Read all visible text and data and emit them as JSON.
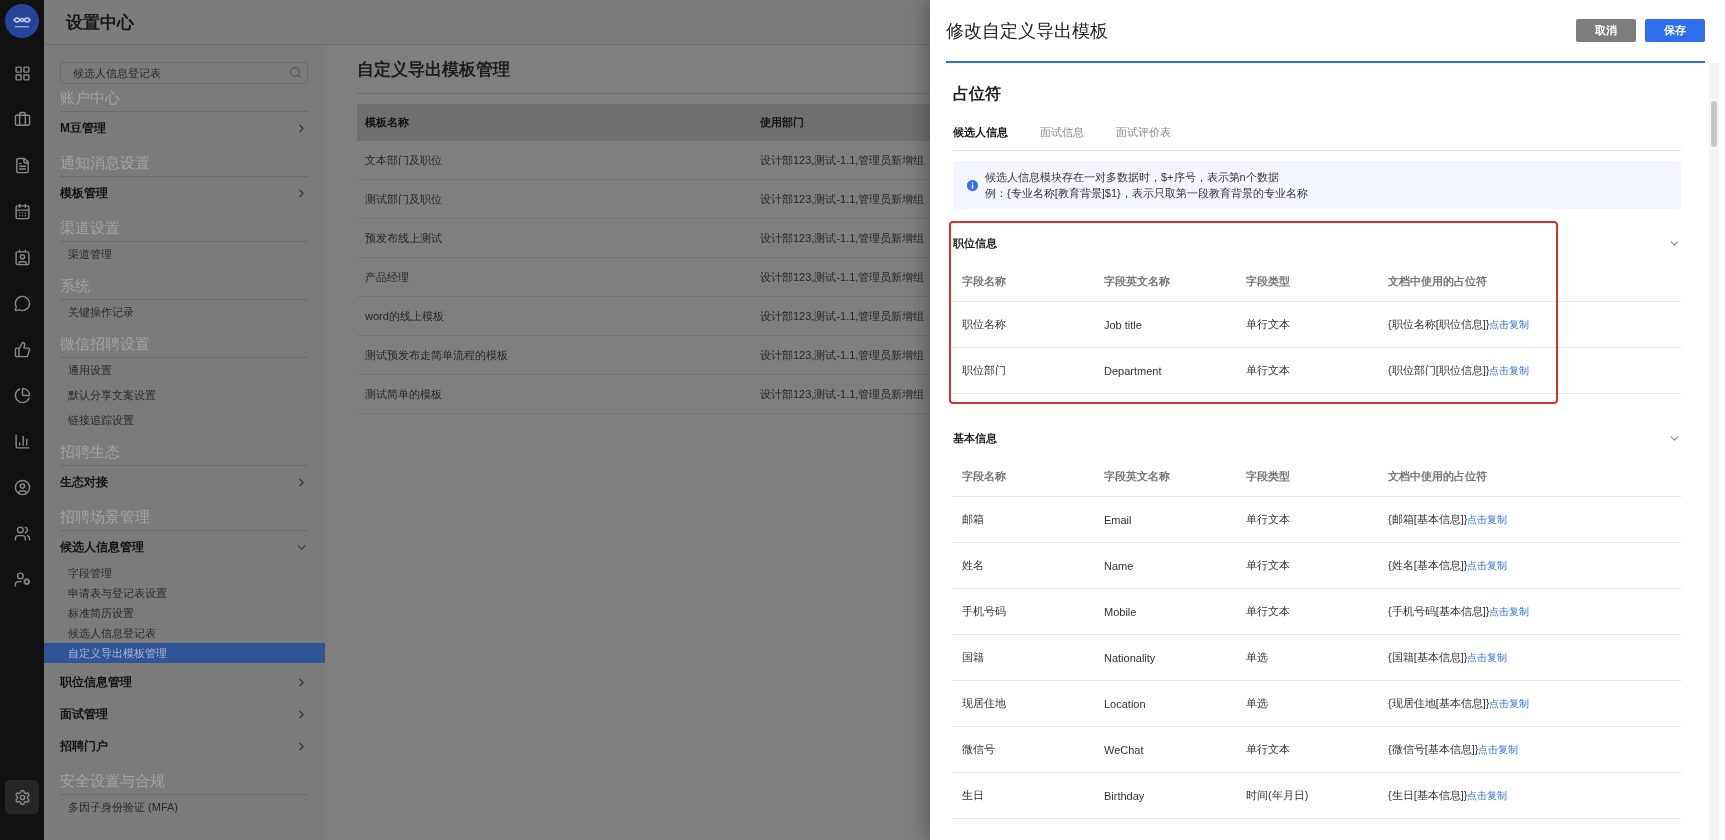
{
  "app_header": {
    "title": "设置中心"
  },
  "rail": [
    {
      "selected": false
    },
    {
      "selected": false
    },
    {
      "selected": false
    },
    {
      "selected": false
    },
    {
      "selected": false
    },
    {
      "selected": false
    },
    {
      "selected": false
    },
    {
      "selected": false
    },
    {
      "selected": false
    },
    {
      "selected": false
    },
    {
      "selected": false
    },
    {
      "selected": false
    },
    {
      "selected": true
    }
  ],
  "settings_nav": {
    "search": {
      "value": "候选人信息登记表"
    },
    "groups": [
      {
        "title": "账户中心",
        "items": [
          {
            "label": "M豆管理",
            "kind": "menu",
            "expanded": false
          }
        ]
      },
      {
        "title": "通知消息设置",
        "items": [
          {
            "label": "模板管理",
            "kind": "menu",
            "expanded": false
          }
        ]
      },
      {
        "title": "渠道设置",
        "items": [
          {
            "label": "渠道管理",
            "kind": "link",
            "selected": false
          }
        ]
      },
      {
        "title": "系统",
        "items": [
          {
            "label": "关键操作记录",
            "kind": "link",
            "selected": false
          }
        ]
      },
      {
        "title": "微信招聘设置",
        "items": [
          {
            "label": "通用设置",
            "kind": "link",
            "selected": false
          },
          {
            "label": "默认分享文案设置",
            "kind": "link",
            "selected": false
          },
          {
            "label": "链接追踪设置",
            "kind": "link",
            "selected": false
          }
        ]
      },
      {
        "title": "招聘生态",
        "items": [
          {
            "label": "生态对接",
            "kind": "menu",
            "expanded": false
          }
        ]
      },
      {
        "title": "招聘场景管理",
        "items": [
          {
            "label": "候选人信息管理",
            "kind": "menu",
            "expanded": true,
            "children": [
              {
                "label": "字段管理",
                "selected": false
              },
              {
                "label": "申请表与登记表设置",
                "selected": false
              },
              {
                "label": "标准简历设置",
                "selected": false
              },
              {
                "label": "候选人信息登记表",
                "selected": false
              },
              {
                "label": "自定义导出模板管理",
                "selected": true
              }
            ]
          },
          {
            "label": "职位信息管理",
            "kind": "menu",
            "expanded": false
          },
          {
            "label": "面试管理",
            "kind": "menu",
            "expanded": false
          },
          {
            "label": "招聘门户",
            "kind": "menu",
            "expanded": false
          }
        ]
      },
      {
        "title": "安全设置与合规",
        "items": [
          {
            "label": "多因子身份验证 (MFA)",
            "kind": "link",
            "selected": false
          }
        ]
      }
    ]
  },
  "page": {
    "title": "自定义导出模板管理",
    "table": {
      "columns": [
        "模板名称",
        "使用部门"
      ],
      "rows": [
        [
          "文本部门及职位",
          "设计部123,测试-1.1,管理员新增组"
        ],
        [
          "测试部门及职位",
          "设计部123,测试-1.1,管理员新增组"
        ],
        [
          "预发布线上测试",
          "设计部123,测试-1.1,管理员新增组"
        ],
        [
          "产品经理",
          "设计部123,测试-1.1,管理员新增组"
        ],
        [
          "word的线上模板",
          "设计部123,测试-1.1,管理员新增组"
        ],
        [
          "测试预发布走简单流程的模板",
          "设计部123,测试-1.1,管理员新增组"
        ],
        [
          "测试简单的模板",
          "设计部123,测试-1.1,管理员新增组"
        ]
      ]
    }
  },
  "drawer": {
    "title": "修改自定义导出模板",
    "buttons": [
      {
        "label": "取消",
        "kind": "secondary"
      },
      {
        "label": "保存",
        "kind": "primary"
      }
    ],
    "section_title": "占位符",
    "tabs": [
      {
        "label": "候选人信息",
        "selected": true
      },
      {
        "label": "面试信息",
        "selected": false
      },
      {
        "label": "面试评价表",
        "selected": false
      }
    ],
    "notice": {
      "lines": [
        "候选人信息模块存在一对多数据时，$+序号，表示第n个数据",
        "例：{专业名称[教育背景]$1}，表示只取第一段教育背景的专业名称"
      ]
    },
    "groups": [
      {
        "title": "职位信息",
        "expanded": true,
        "highlighted": true,
        "columns": [
          "字段名称",
          "字段英文名称",
          "字段类型",
          "文档中使用的占位符"
        ],
        "rows": [
          {
            "name": "职位名称",
            "english": "Job title",
            "type": "单行文本",
            "placeholder": "{职位名称[职位信息]}",
            "action": "点击复制"
          },
          {
            "name": "职位部门",
            "english": "Department",
            "type": "单行文本",
            "placeholder": "{职位部门[职位信息]}",
            "action": "点击复制"
          }
        ]
      },
      {
        "title": "基本信息",
        "expanded": true,
        "highlighted": false,
        "columns": [
          "字段名称",
          "字段英文名称",
          "字段类型",
          "文档中使用的占位符"
        ],
        "rows": [
          {
            "name": "邮箱",
            "english": "Email",
            "type": "单行文本",
            "placeholder": "{邮箱[基本信息]}",
            "action": "点击复制"
          },
          {
            "name": "姓名",
            "english": "Name",
            "type": "单行文本",
            "placeholder": "{姓名[基本信息]}",
            "action": "点击复制"
          },
          {
            "name": "手机号码",
            "english": "Mobile",
            "type": "单行文本",
            "placeholder": "{手机号码[基本信息]}",
            "action": "点击复制"
          },
          {
            "name": "国籍",
            "english": "Nationality",
            "type": "单选",
            "placeholder": "{国籍[基本信息]}",
            "action": "点击复制"
          },
          {
            "name": "现居住地",
            "english": "Location",
            "type": "单选",
            "placeholder": "{现居住地[基本信息]}",
            "action": "点击复制"
          },
          {
            "name": "微信号",
            "english": "WeChat",
            "type": "单行文本",
            "placeholder": "{微信号[基本信息]}",
            "action": "点击复制"
          },
          {
            "name": "生日",
            "english": "Birthday",
            "type": "时间(年月日)",
            "placeholder": "{生日[基本信息]}",
            "action": "点击复制"
          }
        ]
      }
    ]
  }
}
